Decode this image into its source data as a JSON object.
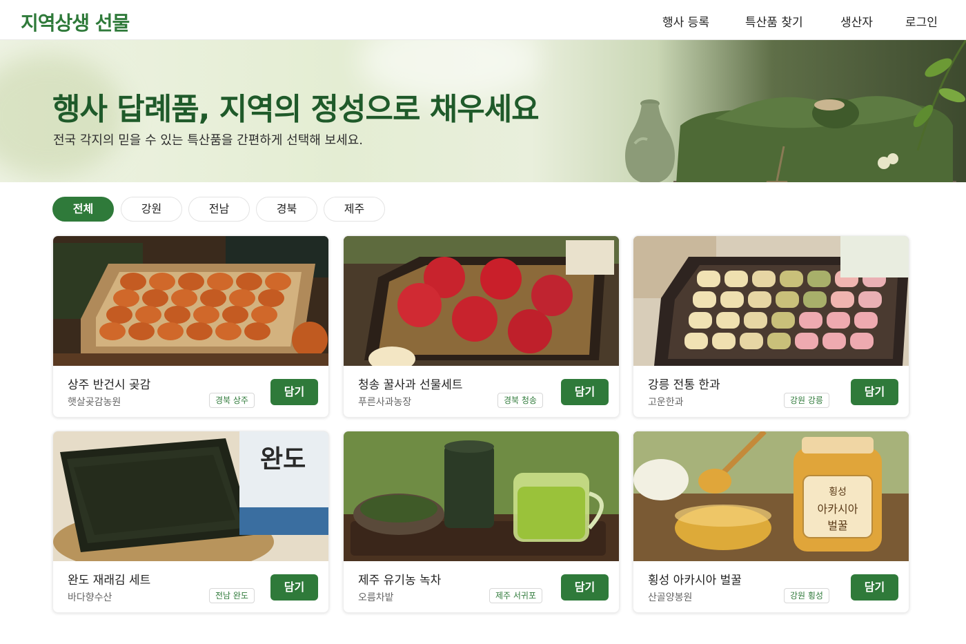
{
  "brand": {
    "logo": "지역상생 선물",
    "accent": "#2f7a3a"
  },
  "nav": {
    "items": [
      "행사 등록",
      "특산품 찾기",
      "생산자",
      "로그인"
    ]
  },
  "hero": {
    "title": "행사 답례품, 지역의 정성으로 채우세요",
    "subtitle": "전국 각지의 믿을 수 있는 특산품을 간편하게 선택해 보세요."
  },
  "filters": {
    "items": [
      "전체",
      "강원",
      "전남",
      "경북",
      "제주"
    ],
    "selected": "전체"
  },
  "products": [
    {
      "name": "상주 반건시 곶감",
      "producer": "햇살곶감농원",
      "region": "경북 상주",
      "button": "담기",
      "image_icon": "dried-persimmon-box"
    },
    {
      "name": "청송 꿀사과 선물세트",
      "producer": "푸른사과농장",
      "region": "경북 청송",
      "button": "담기",
      "image_icon": "apple-box"
    },
    {
      "name": "강릉 전통 한과",
      "producer": "고운한과",
      "region": "강원 강릉",
      "button": "담기",
      "image_icon": "hangwa-box"
    },
    {
      "name": "완도 재래김 세트",
      "producer": "바다향수산",
      "region": "전남 완도",
      "button": "담기",
      "image_icon": "seaweed-stack"
    },
    {
      "name": "제주 유기농 녹차",
      "producer": "오름차밭",
      "region": "제주 서귀포",
      "button": "담기",
      "image_icon": "green-tea"
    },
    {
      "name": "횡성 아카시아 벌꿀",
      "producer": "산골양봉원",
      "region": "강원 횡성",
      "button": "담기",
      "image_icon": "honey-jar"
    }
  ],
  "image_labels": {
    "seaweed_pack": "완도",
    "honey_label": [
      "횡성",
      "아카시아",
      "벌꿀"
    ]
  }
}
